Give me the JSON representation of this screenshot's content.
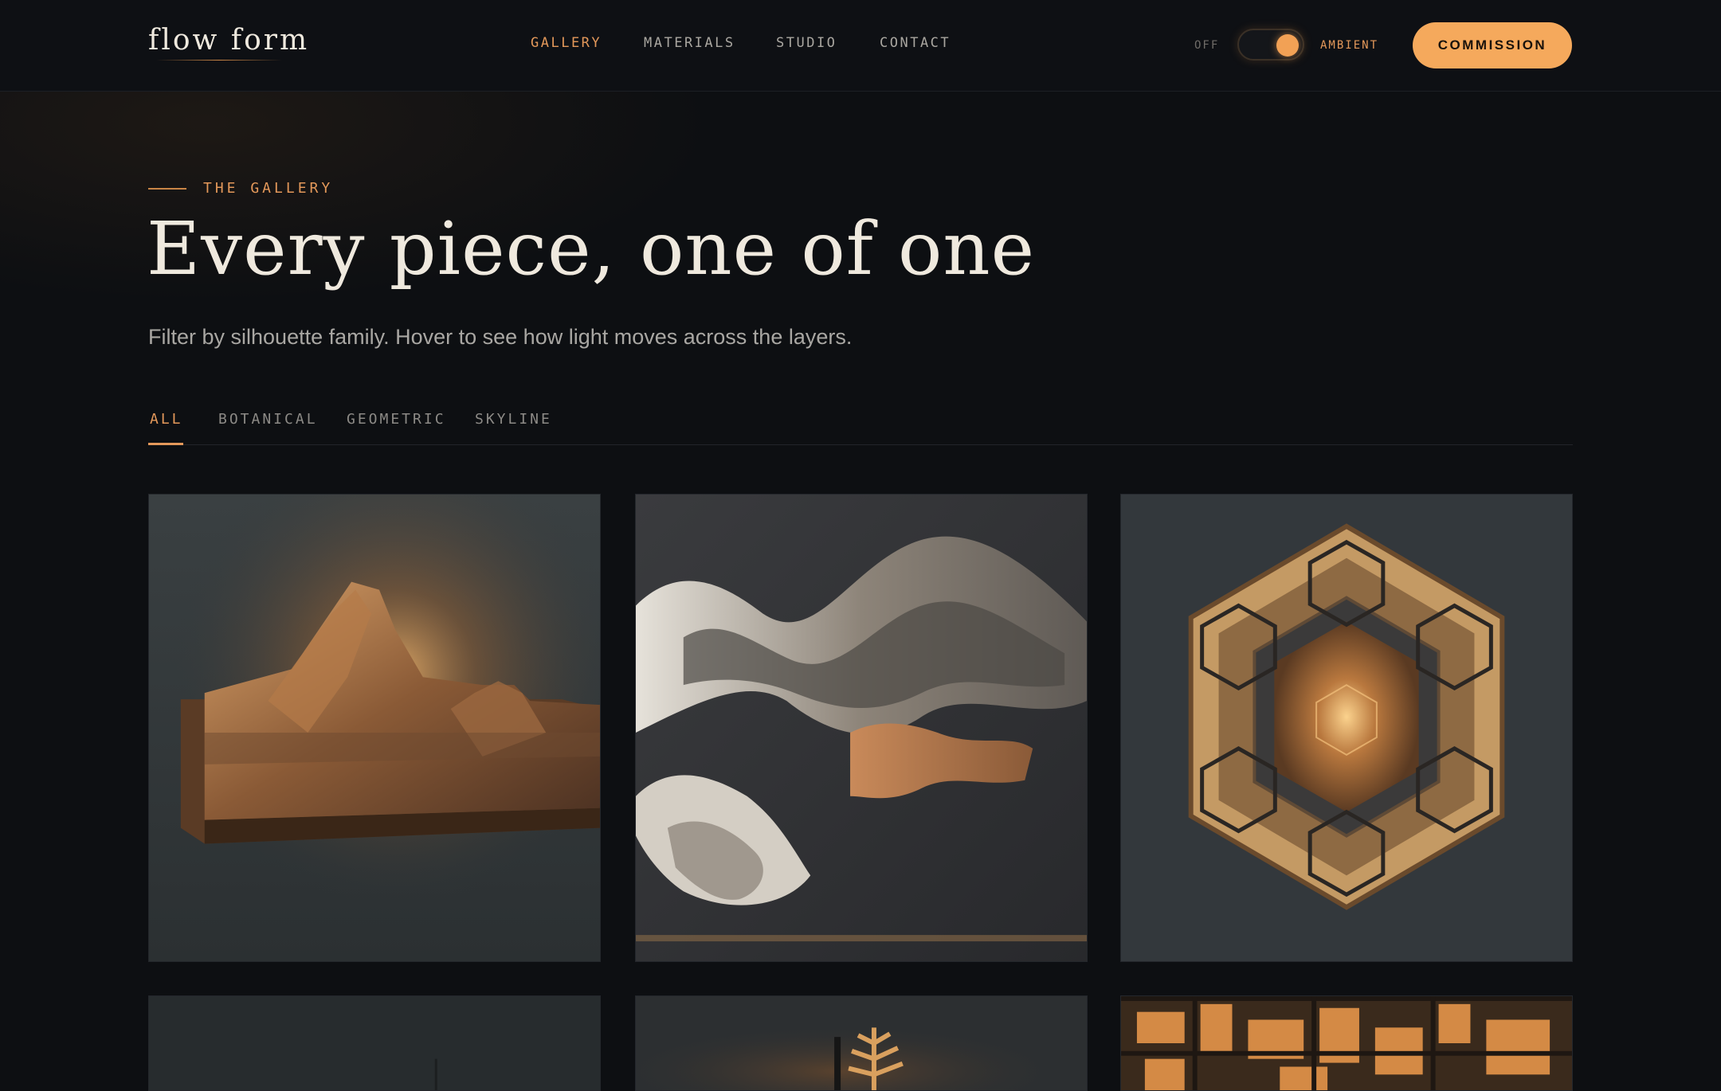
{
  "header": {
    "logo": "flow form",
    "nav": [
      {
        "label": "GALLERY",
        "active": true
      },
      {
        "label": "MATERIALS",
        "active": false
      },
      {
        "label": "STUDIO",
        "active": false
      },
      {
        "label": "CONTACT",
        "active": false
      }
    ],
    "toggle": {
      "off_label": "OFF",
      "on_label": "AMBIENT",
      "state": "on"
    },
    "cta_label": "COMMISSION"
  },
  "hero": {
    "eyebrow": "THE GALLERY",
    "title": "Every piece, one of one",
    "subtitle": "Filter by silhouette family. Hover to see how light moves across the layers."
  },
  "filters": [
    {
      "label": "ALL",
      "active": true
    },
    {
      "label": "BOTANICAL",
      "active": false
    },
    {
      "label": "GEOMETRIC",
      "active": false
    },
    {
      "label": "SKYLINE",
      "active": false
    }
  ],
  "gallery": {
    "items": [
      {
        "subject": "layered wooden mountain relief with backlight"
      },
      {
        "subject": "layered stone and wood wave relief"
      },
      {
        "subject": "geometric hexagon lattice wall art"
      },
      {
        "subject": "dark panel (partially visible)"
      },
      {
        "subject": "botanical fern silhouette (partially visible)"
      },
      {
        "subject": "skyline grid lattice with warm glow (partially visible)"
      }
    ]
  },
  "colors": {
    "background": "#0d0f12",
    "accent": "#e3985a",
    "cta": "#f5a95c",
    "text": "#efe9de",
    "muted": "#a9a7a3"
  }
}
